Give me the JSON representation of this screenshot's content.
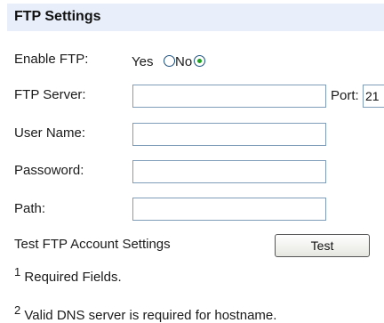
{
  "section": {
    "title": "FTP Settings"
  },
  "enable_ftp": {
    "label": "Enable FTP:",
    "yes_label": "Yes",
    "no_label": "No",
    "selected": "No"
  },
  "ftp_server": {
    "label": "FTP Server:",
    "value": ""
  },
  "port": {
    "label": "Port:",
    "value": "21"
  },
  "user_name": {
    "label": "User Name:",
    "value": ""
  },
  "password": {
    "label": "Passoword:",
    "value": ""
  },
  "path": {
    "label": "Path:",
    "value": ""
  },
  "test": {
    "label": "Test FTP Account Settings",
    "button": "Test"
  },
  "notes": [
    {
      "marker": "1",
      "text": "Required Fields."
    },
    {
      "marker": "2",
      "text": "Valid DNS server is required for hostname."
    }
  ]
}
